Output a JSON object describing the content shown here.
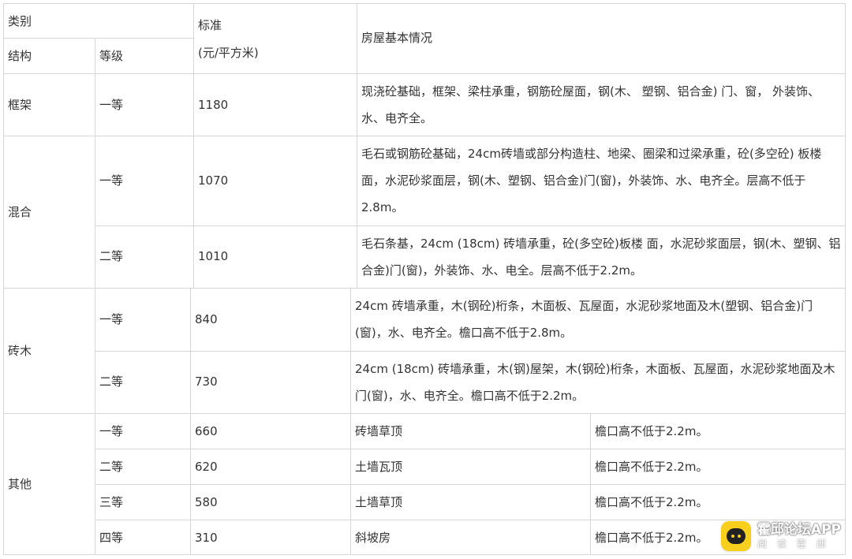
{
  "header": {
    "category": "类别",
    "structure": "结构",
    "grade": "等级",
    "standard": "标准",
    "unit": "(元/平方米)",
    "description": "房屋基本情况"
  },
  "rows": {
    "frame": {
      "structure": "框架",
      "grade": "一等",
      "price": "1180",
      "desc_line1": "现浇砼基础，框架、梁柱承重，钢筋砼屋面，钢(木、 塑钢、铝合金) 门、窗， 外装饰、",
      "desc_line2": "水、电齐全。"
    },
    "mixed": {
      "structure": "混合",
      "g1": {
        "grade": "一等",
        "price": "1070",
        "desc_line1": "毛石或钢筋砼基础，24cm砖墙或部分构造柱、地梁、圈梁和过梁承重，砼(多空砼) 板楼",
        "desc_line2": "面，水泥砂浆面层，钢(木、塑钢、铝合金)门(窗)，外装饰、水、电齐全。层高不低于",
        "desc_line3": "2.8m。"
      },
      "g2": {
        "grade": "二等",
        "price": "1010",
        "desc_line1": "毛石条基，24cm (18cm) 砖墙承重，砼(多空砼)板楼 面，水泥砂浆面层，钢(木、塑钢、铝",
        "desc_line2": "合金)门(窗)，外装饰、水、电全。层高不低于2.2m。"
      }
    },
    "brickwood": {
      "structure": "砖木",
      "g1": {
        "grade": "一等",
        "price": "840",
        "desc_line1": "24cm 砖墙承重，木(钢砼)桁条，木面板、瓦屋面，水泥砂浆地面及木(塑钢、铝合金)门",
        "desc_line2": "(窗)，水、电齐全。檐口高不低于2.8m。"
      },
      "g2": {
        "grade": "二等",
        "price": "730",
        "desc_line1": "24cm (18cm) 砖墙承重，木(钢)屋架，木(钢砼)桁条，木面板、瓦屋面，水泥砂浆地面及木",
        "desc_line2": "门(窗)，水、电齐全。檐口高不低于2.2m。"
      }
    },
    "other": {
      "structure": "其他",
      "items": [
        {
          "grade": "一等",
          "price": "660",
          "desc": "砖墙草顶",
          "note": "檐口高不低于2.2m。"
        },
        {
          "grade": "二等",
          "price": "620",
          "desc": "土墙瓦顶",
          "note": "檐口高不低于2.2m。"
        },
        {
          "grade": "三等",
          "price": "580",
          "desc": "土墙草顶",
          "note": "檐口高不低于2.2m。"
        },
        {
          "grade": "四等",
          "price": "310",
          "desc": "斜坡房",
          "note": "檐口高不低于2.2m。"
        }
      ]
    }
  },
  "watermark": {
    "title": "霍邱论坛APP",
    "subtitle": "阅读霍邱",
    "icon": "chat-bubble-icon",
    "badge_color": "#f8cf1c"
  }
}
